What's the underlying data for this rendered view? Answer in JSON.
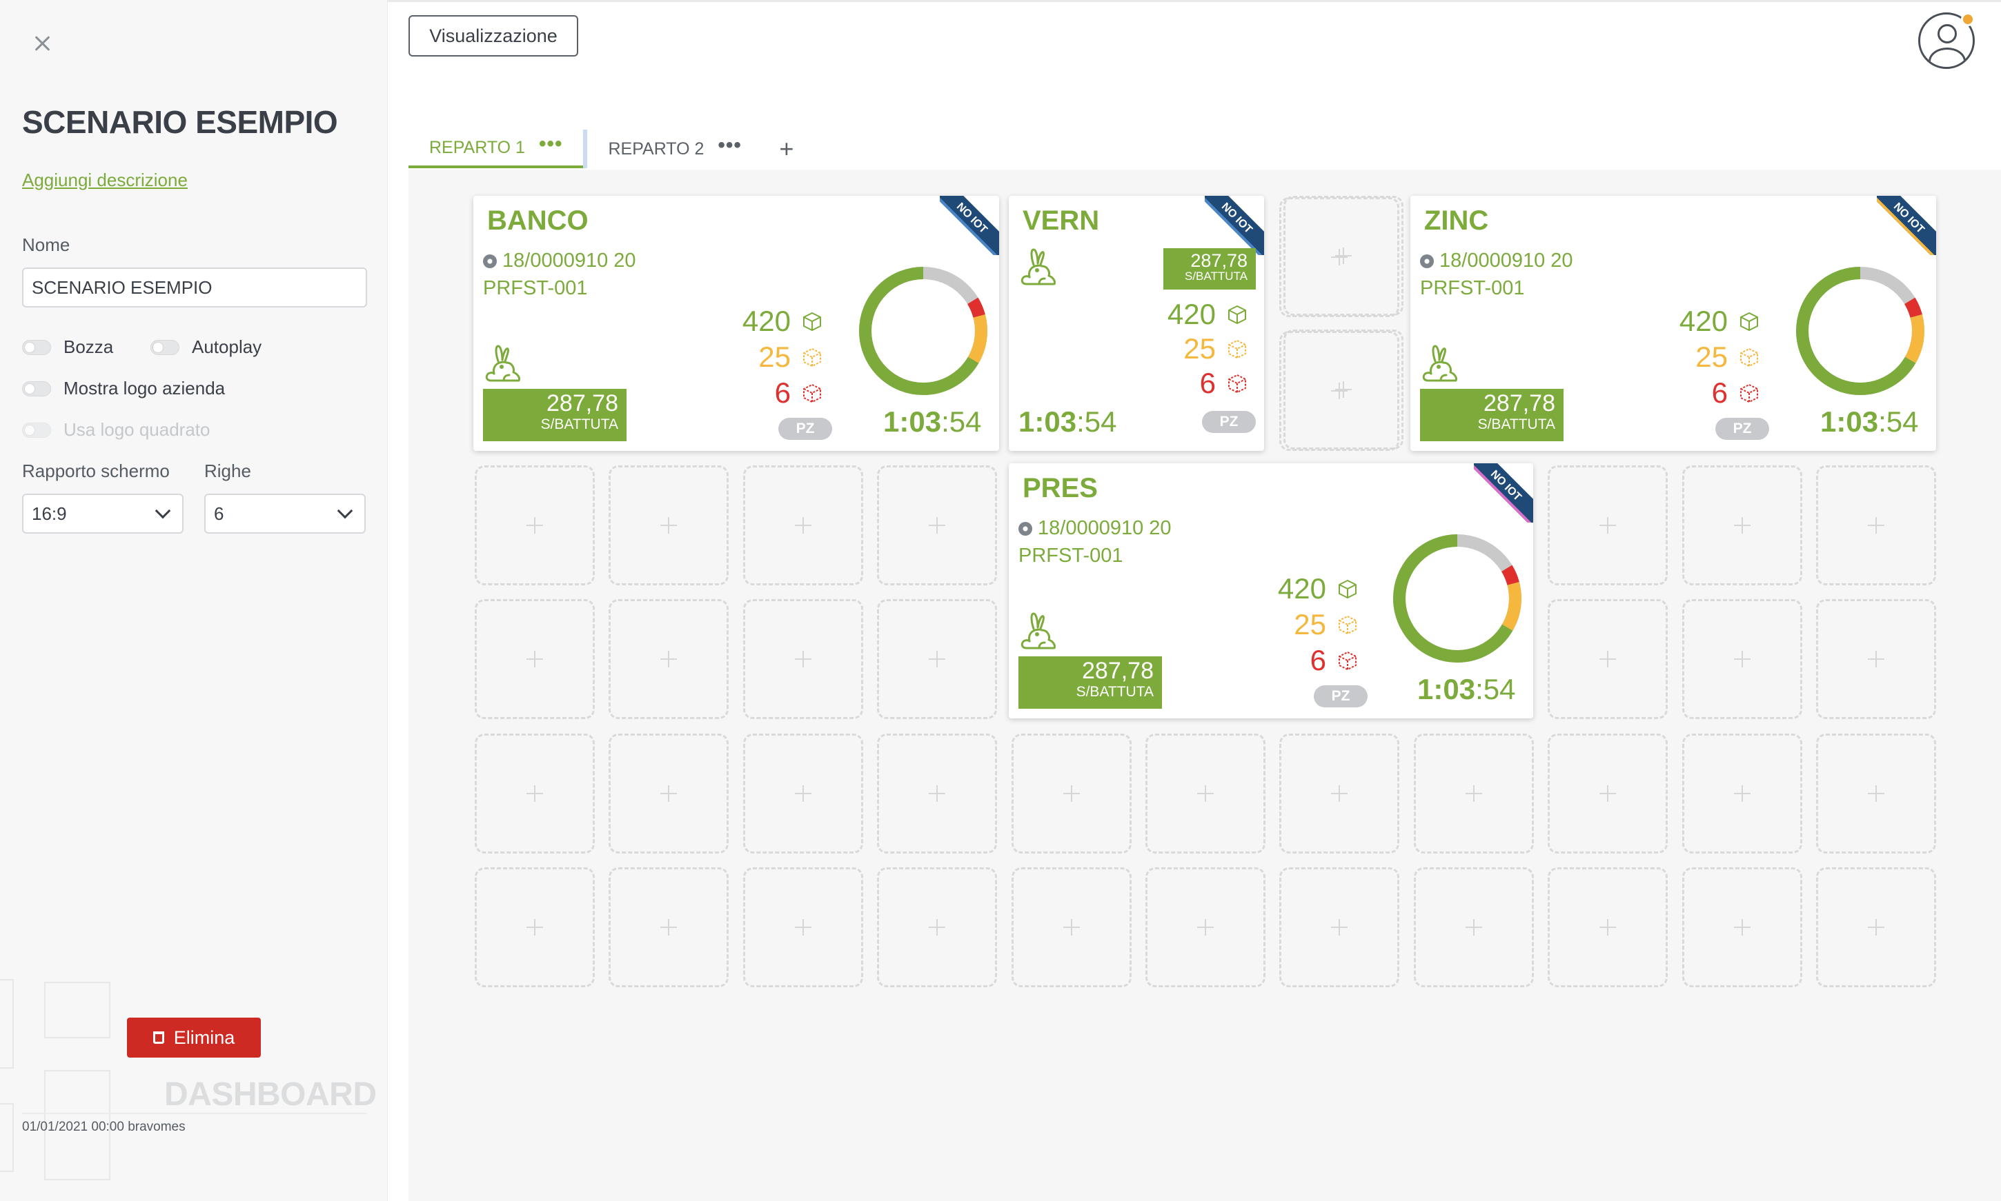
{
  "sidebar": {
    "title": "SCENARIO ESEMPIO",
    "add_description": "Aggiungi descrizione",
    "name_label": "Nome",
    "name_value": "SCENARIO ESEMPIO",
    "toggles": {
      "draft": "Bozza",
      "autoplay": "Autoplay",
      "show_logo": "Mostra logo azienda",
      "square_logo": "Usa logo quadrato"
    },
    "ratio_label": "Rapporto schermo",
    "ratio_value": "16:9",
    "rows_label": "Righe",
    "rows_value": "6",
    "delete_label": "Elimina",
    "watermark": "DASHBOARD",
    "meta": "01/01/2021 00:00 bravomes"
  },
  "header": {
    "view_button": "Visualizzazione",
    "tabs": [
      {
        "label": "REPARTO 1",
        "menu": "•••"
      },
      {
        "label": "REPARTO 2",
        "menu": "•••"
      }
    ],
    "add_tab": "+"
  },
  "colors": {
    "accent": "#7cab3b",
    "warning": "#f5b73d",
    "danger": "#e0302d",
    "delete": "#cc2a22",
    "ribbon": "#1f4a78"
  },
  "cards": [
    {
      "name": "BANCO",
      "order": "18/0000910 20",
      "part": "PRFST-001",
      "rate": "287,78",
      "rate_unit": "S/BATTUTA",
      "good": "420",
      "warn": "25",
      "scrap": "6",
      "unit": "PZ",
      "timer_main": "1:03",
      "timer_sec": ":54",
      "badge": "NO IOT",
      "badge_color": "#4a86c5"
    },
    {
      "name": "VERN",
      "rate": "287,78",
      "rate_unit": "S/BATTUTA",
      "good": "420",
      "warn": "25",
      "scrap": "6",
      "unit": "PZ",
      "timer_main": "1:03",
      "timer_sec": ":54",
      "badge": "NO IOT",
      "badge_color": "#4a86c5"
    },
    {
      "name": "ZINC",
      "order": "18/0000910 20",
      "part": "PRFST-001",
      "rate": "287,78",
      "rate_unit": "S/BATTUTA",
      "good": "420",
      "warn": "25",
      "scrap": "6",
      "unit": "PZ",
      "timer_main": "1:03",
      "timer_sec": ":54",
      "badge": "NO IOT",
      "badge_color": "#f5b73d"
    },
    {
      "name": "PRES",
      "order": "18/0000910 20",
      "part": "PRFST-001",
      "rate": "287,78",
      "rate_unit": "S/BATTUTA",
      "good": "420",
      "warn": "25",
      "scrap": "6",
      "unit": "PZ",
      "timer_main": "1:03",
      "timer_sec": ":54",
      "badge": "NO IOT",
      "badge_color": "#d96ec9"
    }
  ]
}
